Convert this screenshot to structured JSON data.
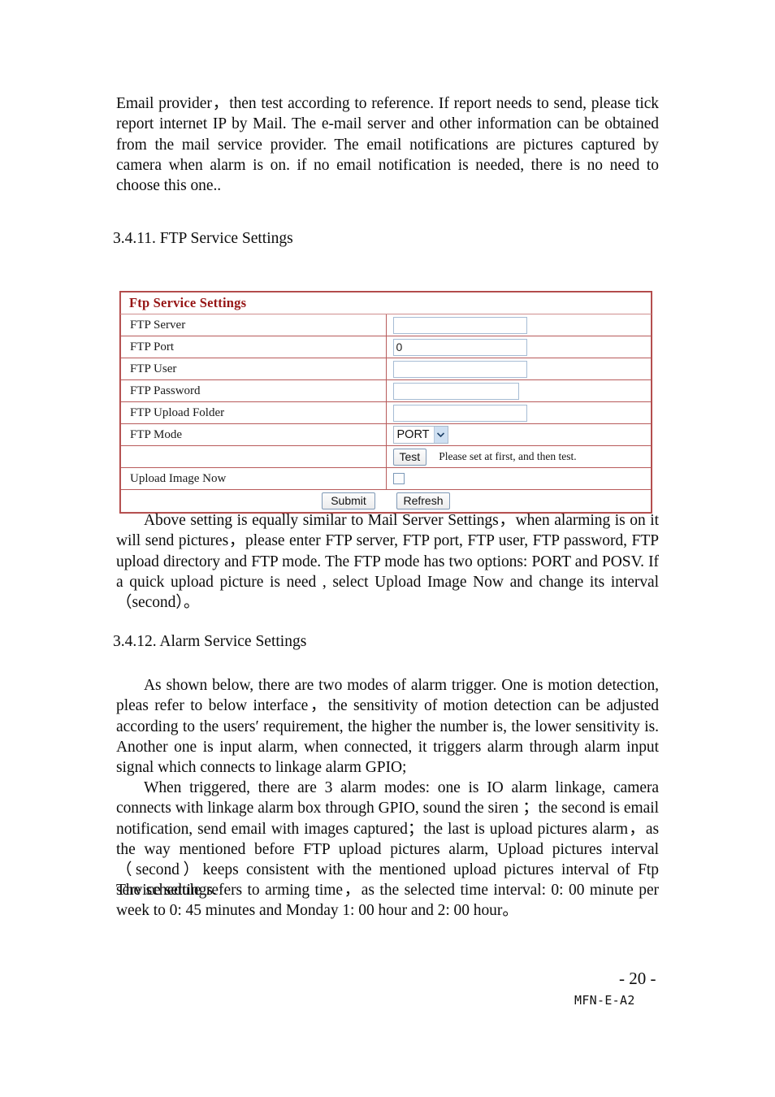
{
  "document": {
    "intro_paragraph": "Email provider，then test according to reference. If report needs to send, please tick report internet IP by Mail. The e-mail server and other information can be obtained from the mail service provider. The email notifications are pictures captured by camera when alarm is on. if no email notification is needed, there is no need to choose this one..",
    "section_ftp_heading": "3.4.11. FTP Service Settings",
    "ftp_description_paragraph": "Above setting is equally similar to Mail Server Settings，when alarming is on it will send pictures，please enter FTP server, FTP port, FTP user, FTP password, FTP upload directory and FTP mode. The FTP mode has two options:  PORT and POSV. If  a quick upload picture is need , select Upload Image Now and change its interval （second）。",
    "section_alarm_heading": "3.4.12. Alarm Service Settings",
    "alarm_paragraph_1": "As shown below, there are two modes of alarm trigger. One is motion detection, pleas refer to below interface，the sensitivity of motion detection can be adjusted according to the users′  requirement, the higher the number is, the lower sensitivity is. Another one is input alarm, when connected, it triggers alarm through alarm input signal which connects to linkage alarm GPIO;",
    "alarm_paragraph_2": "When triggered, there are 3 alarm modes: one is IO alarm linkage, camera connects with linkage alarm box through GPIO, sound the siren ；the second is email notification, send email with images captured；the last is upload pictures alarm，as the way mentioned before FTP upload pictures alarm, Upload pictures interval（second）keeps consistent with the mentioned upload pictures interval of Ftp service settings.",
    "alarm_paragraph_3": "The schedule refers to arming time，as the selected time interval:  0: 00 minute per week to 0: 45 minutes and Monday 1: 00 hour and 2: 00 hour。"
  },
  "ftp_panel": {
    "title": "Ftp Service Settings",
    "rows": [
      {
        "label": "FTP Server",
        "value": ""
      },
      {
        "label": "FTP Port",
        "value": "0"
      },
      {
        "label": "FTP User",
        "value": ""
      },
      {
        "label": "FTP Password",
        "value": ""
      },
      {
        "label": "FTP Upload Folder",
        "value": ""
      }
    ],
    "mode_label": "FTP Mode",
    "mode_value": "PORT",
    "mode_options": [
      "PORT",
      "POSV"
    ],
    "test_button": "Test",
    "test_hint": "Please set at first, and then test.",
    "upload_now_label": "Upload Image Now",
    "upload_now_checked": false,
    "submit_button": "Submit",
    "refresh_button": "Refresh",
    "colors": {
      "border": "#b85b5b",
      "title_text": "#961515",
      "input_border": "#a6bcd4",
      "select_arrow_bg": "#cfe0f2"
    }
  },
  "footer": {
    "page_number": "- 20 -",
    "doc_code": "MFN-E-A2"
  }
}
